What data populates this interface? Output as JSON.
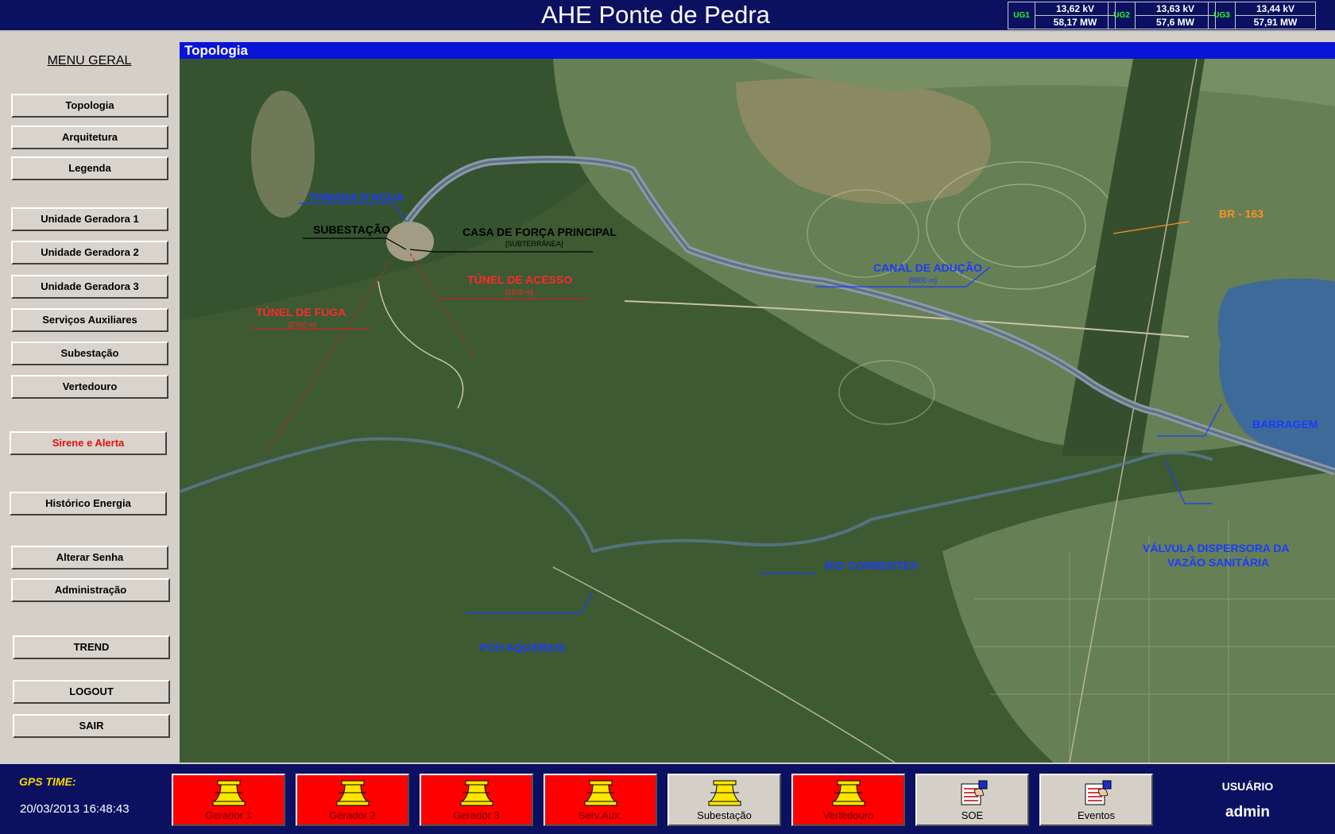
{
  "header": {
    "title": "AHE Ponte de Pedra",
    "units": [
      {
        "label": "UG1",
        "voltage": "13,62  kV",
        "power": "58,17  MW"
      },
      {
        "label": "UG2",
        "voltage": "13,63  kV",
        "power": "57,6  MW"
      },
      {
        "label": "UG3",
        "voltage": "13,44  kV",
        "power": "57,91  MW"
      }
    ]
  },
  "sidebar": {
    "title": "MENU GERAL",
    "items": {
      "topologia": "Topologia",
      "arquitetura": "Arquitetura",
      "legenda": "Legenda",
      "ug1": "Unidade Geradora 1",
      "ug2": "Unidade Geradora 2",
      "ug3": "Unidade Geradora 3",
      "servicos": "Serviços Auxiliares",
      "subestacao": "Subestação",
      "vertedouro": "Vertedouro",
      "sirene": "Sirene e Alerta",
      "historico": "Histórico Energia",
      "senha": "Alterar Senha",
      "admin": "Administração",
      "trend": "TREND",
      "logout": "LOGOUT",
      "sair": "SAIR"
    }
  },
  "panel": {
    "title": "Topologia"
  },
  "map": {
    "labels": {
      "tomada": "TOMADA D'ÁGUA",
      "subestacao": "SUBESTAÇÃO",
      "casa": "CASA DE FORÇA PRINCIPAL",
      "casa_sub": "[SUBTERRÂNEA]",
      "tunel_acesso": "TÚNEL DE ACESSO",
      "tunel_acesso_sub": "[1500 m]",
      "tunel_fuga": "TÚNEL DE FUGA",
      "tunel_fuga_sub": "[2700 m]",
      "canal": "CANAL DE ADUÇÃO",
      "canal_sub": "[9900 m]",
      "br": "BR - 163",
      "barragem": "BARRAGEM",
      "valvula_1": "VÁLVULA DISPERSORA DA",
      "valvula_2": "VAZÃO SANITÁRIA",
      "rio": "RIO CORRENTES",
      "pch": "PCH AQUÁRIUS"
    }
  },
  "footer": {
    "gps_label": "GPS TIME:",
    "gps_time": "20/03/2013 16:48:43",
    "buttons": {
      "gerador1": "Gerador 1",
      "gerador2": "Gerador 2",
      "gerador3": "Gerador 3",
      "servaux": "Serv.Aux.",
      "subestacao": "Subestação",
      "vertedouro": "Vertedouro",
      "soe": "SOE",
      "eventos": "Eventos"
    },
    "user_label": "USUÁRIO",
    "user_name": "admin"
  },
  "colors": {
    "title_bar": "#0b1160",
    "panel_header": "#0a14d8",
    "alarm_red": "#ff0000",
    "ug_label_green": "#22ff22",
    "map_label_blue": "#1a3cff",
    "map_label_red": "#ff2a2a",
    "map_label_orange": "#ff9020"
  }
}
